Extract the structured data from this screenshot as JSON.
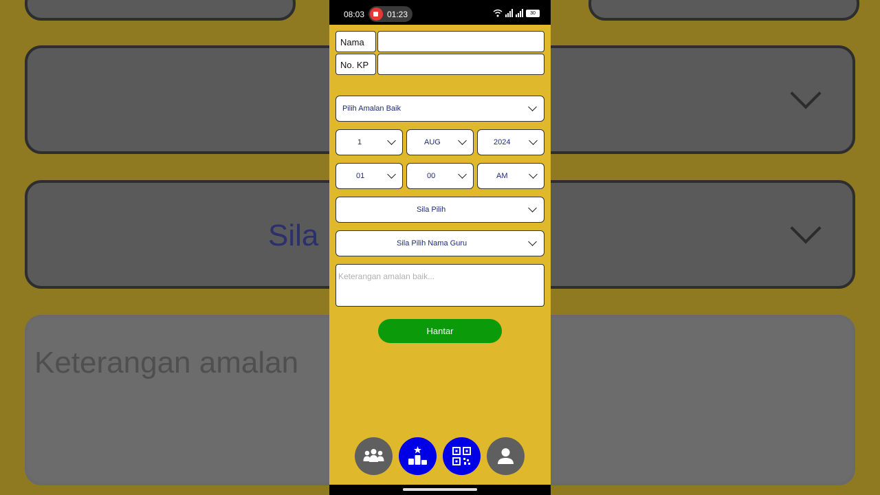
{
  "colors": {
    "phone_bg": "#dfb82c",
    "accent_blue": "#0000e6",
    "submit_green": "#0a9a0a",
    "nav_grey": "#5f5f5f",
    "select_text": "#1d2a7a"
  },
  "status_bar": {
    "time": "08:03",
    "recording_time": "01:23",
    "battery": "30"
  },
  "form": {
    "nama_label": "Nama",
    "nokp_label": "No. KP",
    "nama_value": "",
    "nokp_value": "",
    "amalan_select": "Pilih Amalan Baik",
    "day": "1",
    "month": "AUG",
    "year": "2024",
    "hour": "01",
    "minute": "00",
    "ampm": "AM",
    "category_select": "Sila Pilih",
    "teacher_select": "Sila Pilih Nama Guru",
    "notes_placeholder": "Keterangan amalan baik...",
    "submit_label": "Hantar"
  },
  "background": {
    "category_text": "Sila P",
    "notes_text": "Keterangan amalan"
  },
  "bottom_nav": [
    {
      "icon": "group-icon",
      "active": false
    },
    {
      "icon": "podium-icon",
      "active": true
    },
    {
      "icon": "qr-code-icon",
      "active": true
    },
    {
      "icon": "person-icon",
      "active": false
    }
  ]
}
